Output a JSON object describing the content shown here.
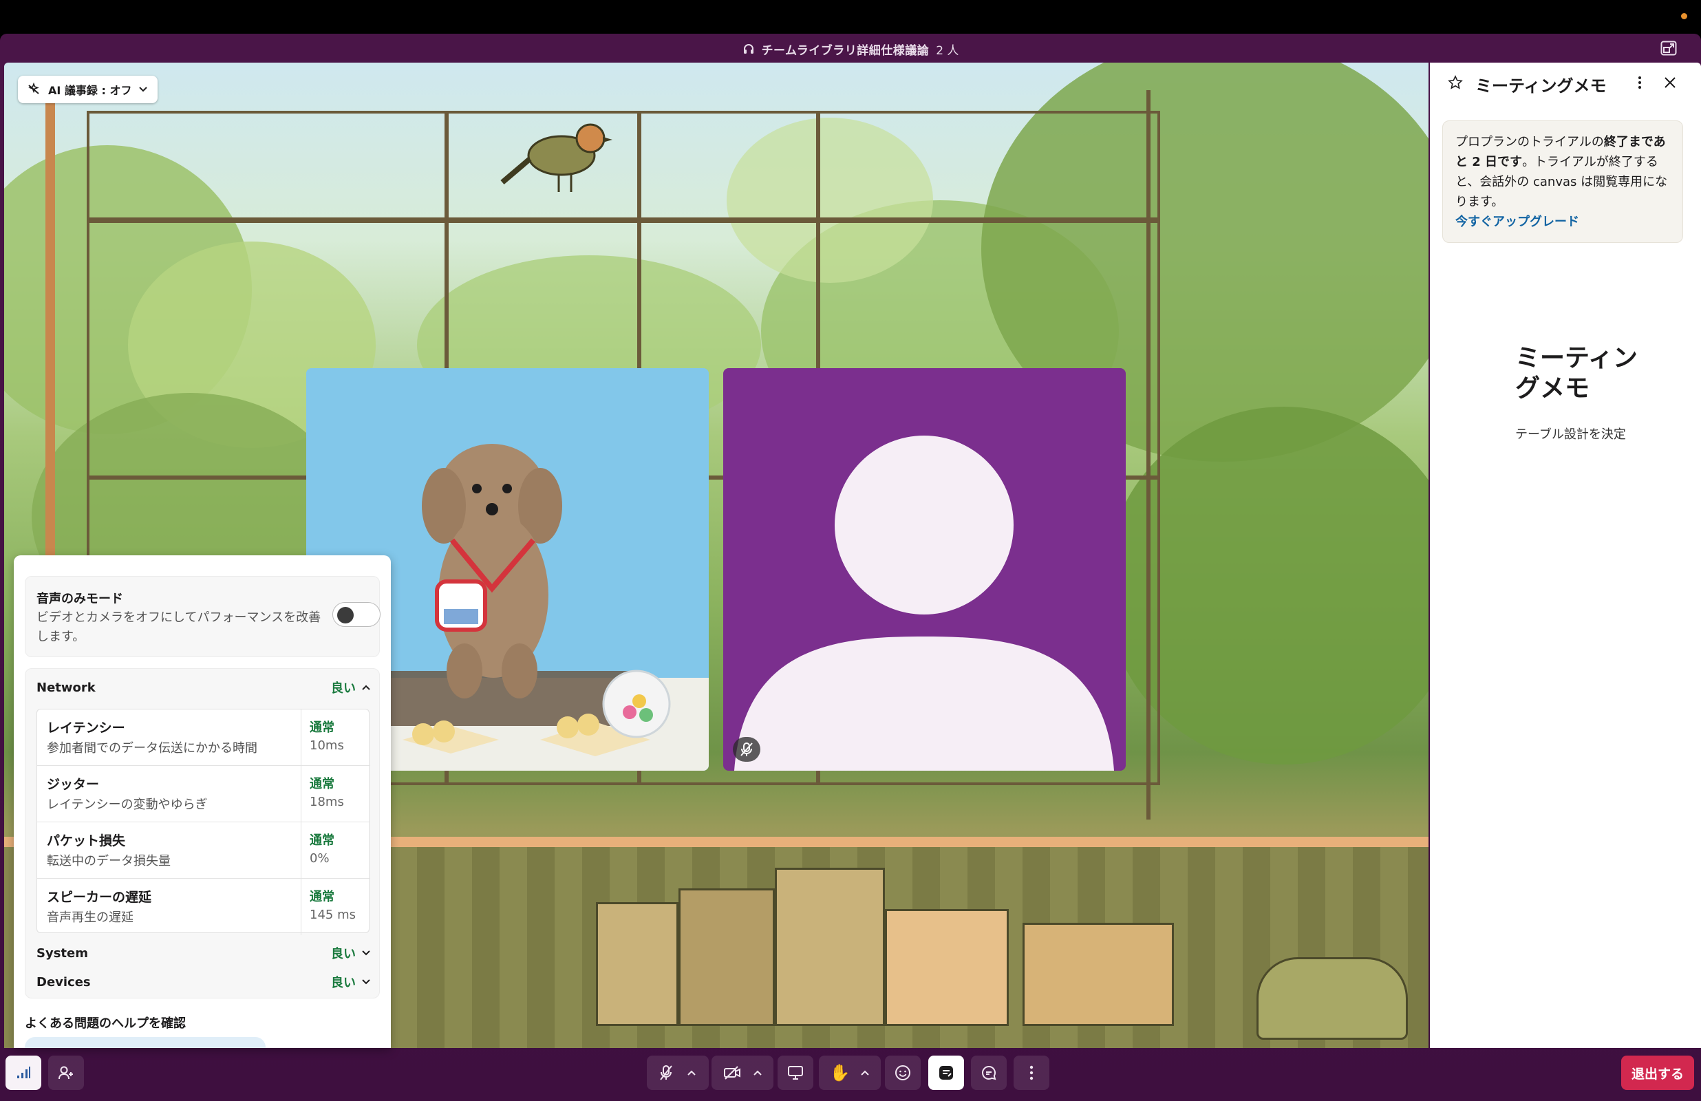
{
  "window": {
    "title": "チームライブラリ詳細仕様議論",
    "participant_count": "2 人",
    "headphone_icon": "headphones-icon",
    "popout_icon": "popout-icon"
  },
  "stage": {
    "ai_notes_label": "AI 議事録 : オフ"
  },
  "connection_panel": {
    "audio_only": {
      "title": "音声のみモード",
      "description": "ビデオとカメラをオフにしてパフォーマンスを改善します。",
      "enabled": false
    },
    "network": {
      "label": "Network",
      "status": "良い",
      "metrics": [
        {
          "name": "レイテンシー",
          "description": "参加者間でのデータ伝送にかかる時間",
          "status": "通常",
          "value": "10ms"
        },
        {
          "name": "ジッター",
          "description": "レイテンシーの変動やゆらぎ",
          "status": "通常",
          "value": "18ms"
        },
        {
          "name": "パケット損失",
          "description": "転送中のデータ損失量",
          "status": "通常",
          "value": "0%"
        },
        {
          "name": "スピーカーの遅延",
          "description": "音声再生の遅延",
          "status": "通常",
          "value": "145 ms"
        }
      ]
    },
    "system": {
      "label": "System",
      "status": "良い"
    },
    "devices": {
      "label": "Devices",
      "status": "良い"
    },
    "help_title": "よくある問題のヘルプを確認",
    "status_color": "#1a7a3e"
  },
  "notes_panel": {
    "title": "ミーティングメモ",
    "trial_text_1": "プロプランのトライアルの",
    "trial_text_bold": "終了まであと 2 日です",
    "trial_text_2": "。トライアルが終了すると、会話外の canvas は閲覧専用になります。",
    "upgrade_link": "今すぐアップグレード",
    "heading": "ミーティングメモ",
    "body": "テーブル設計を決定"
  },
  "controls": {
    "leave_label": "退出する",
    "leave_color": "#d2284f"
  }
}
